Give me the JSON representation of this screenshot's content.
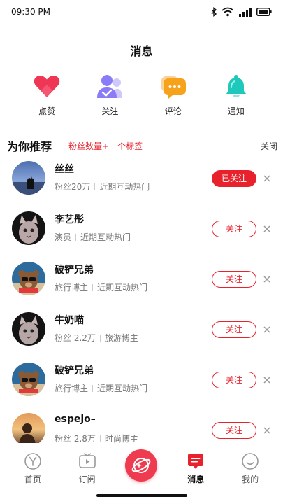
{
  "status_bar": {
    "time": "09:30 PM"
  },
  "page": {
    "title": "消息"
  },
  "categories": [
    {
      "label": "点赞",
      "icon": "heart-icon",
      "color": "#ef3654"
    },
    {
      "label": "关注",
      "icon": "person-check-icon",
      "color": "#8a7cf6"
    },
    {
      "label": "评论",
      "icon": "comment-icon",
      "color": "#f6a21b"
    },
    {
      "label": "通知",
      "icon": "bell-icon",
      "color": "#1ec8bb"
    }
  ],
  "recommend": {
    "title": "为你推荐",
    "note": "粉丝数量+一个标签",
    "close": "关闭",
    "items": [
      {
        "name": "丝丝",
        "tag1": "粉丝20万",
        "tag2": "近期互动热门",
        "button": "已关注",
        "followed": true
      },
      {
        "name": "李艺彤",
        "tag1": "演员",
        "tag2": "近期互动热门",
        "button": "关注",
        "followed": false
      },
      {
        "name": "破铲兄弟",
        "tag1": "旅行博主",
        "tag2": "近期互动热门",
        "button": "关注",
        "followed": false
      },
      {
        "name": "牛奶喵",
        "tag1": "粉丝 2.2万",
        "tag2": "旅游博主",
        "button": "关注",
        "followed": false
      },
      {
        "name": "破铲兄弟",
        "tag1": "旅行博主",
        "tag2": "近期互动热门",
        "button": "关注",
        "followed": false
      },
      {
        "name": "espejo–",
        "tag1": "粉丝 2.8万",
        "tag2": "时尚博主",
        "button": "关注",
        "followed": false
      }
    ]
  },
  "tabbar": {
    "tabs": [
      {
        "label": "首页",
        "icon": "home-icon"
      },
      {
        "label": "订阅",
        "icon": "subscribe-icon"
      },
      {
        "label": "",
        "icon": "create-icon"
      },
      {
        "label": "消息",
        "icon": "message-icon",
        "active": true
      },
      {
        "label": "我的",
        "icon": "profile-icon"
      }
    ]
  },
  "colors": {
    "accent": "#e8222d"
  }
}
